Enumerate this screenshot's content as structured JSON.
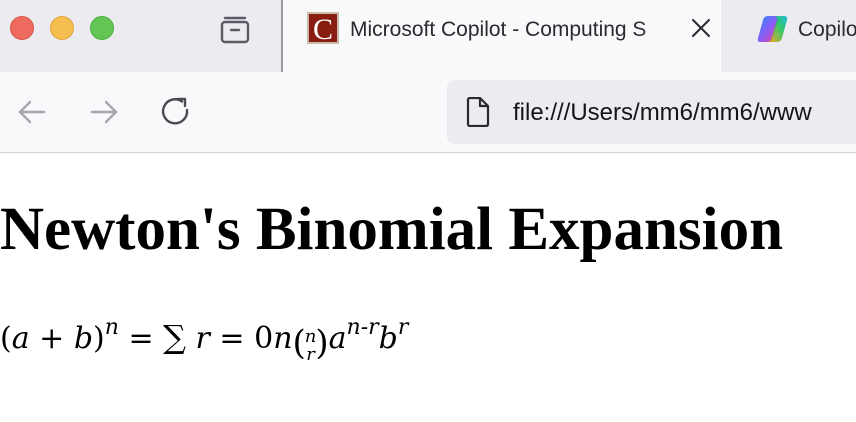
{
  "tabs": {
    "active": {
      "favicon_letter": "C",
      "title": "Microsoft Copilot - Computing S"
    },
    "inactive": {
      "title": "Copilo"
    }
  },
  "navbar": {
    "url": "file:///Users/mm6/mm6/www"
  },
  "page": {
    "title": "Newton's Binomial Expansion",
    "formula": {
      "open_paren": "(",
      "a": "a",
      "plus": " + ",
      "b": "b",
      "close_paren": ")",
      "exp_n": "n",
      "equals": " = ",
      "sum_symbol": "∑",
      "r": "r",
      "equals_zero": " = 0",
      "n": "n",
      "binom_top": "n",
      "binom_bottom": "r",
      "a2": "a",
      "exp_a": "n-r",
      "b2": "b",
      "exp_b": "r"
    }
  },
  "colors": {
    "close": "#ee6a5f",
    "minimize": "#f5be4f",
    "maximize": "#62c554",
    "favicon_bg": "#8a1d12"
  },
  "icons": {
    "tab_overview": "tab-overview-icon",
    "close_tab": "close-icon",
    "back": "back-arrow-icon",
    "forward": "forward-arrow-icon",
    "reload": "reload-icon",
    "page": "document-icon",
    "copilot": "copilot-icon"
  }
}
